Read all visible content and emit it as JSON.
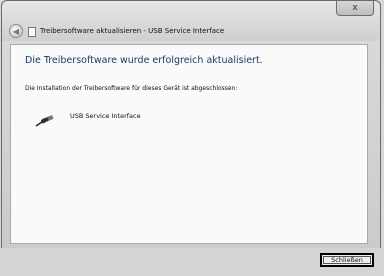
{
  "window": {
    "title": "Treibersoftware aktualisieren - USB Service Interface",
    "close_glyph": "x"
  },
  "main": {
    "heading": "Die Treibersoftware wurde erfolgreich aktualisiert.",
    "subtext": "Die Installation der Treibersoftware für dieses Gerät ist abgeschlossen:",
    "device": {
      "name": "USB Service Interface",
      "icon": "usb-plug-icon"
    }
  },
  "footer": {
    "close_label": "Schließen"
  }
}
